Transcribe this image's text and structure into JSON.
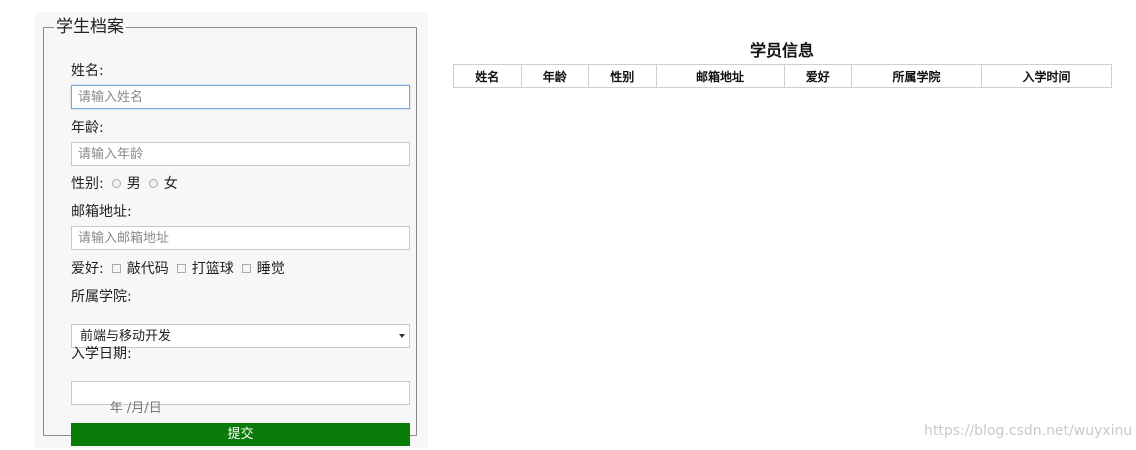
{
  "form": {
    "legend": "学生档案",
    "name": {
      "label": "姓名:",
      "placeholder": "请输入姓名"
    },
    "age": {
      "label": "年龄:",
      "placeholder": "请输入年龄"
    },
    "gender": {
      "label": "性别:",
      "options": [
        "男",
        "女"
      ]
    },
    "email": {
      "label": "邮箱地址:",
      "placeholder": "请输入邮箱地址"
    },
    "hobbies": {
      "label": "爱好:",
      "options": [
        "敲代码",
        "打篮球",
        "睡觉"
      ]
    },
    "college": {
      "label": "所属学院:",
      "selected": "前端与移动开发"
    },
    "enroll_date": {
      "label": "入学日期:",
      "placeholder": "年 /月/日"
    },
    "submit_label": "提交"
  },
  "table": {
    "title": "学员信息",
    "columns": [
      "姓名",
      "年龄",
      "性别",
      "邮箱地址",
      "爱好",
      "所属学院",
      "入学时间"
    ]
  },
  "watermark": "https://blog.csdn.net/wuyxinu",
  "colors": {
    "submit_bg": "#0a7c0a",
    "panel_bg": "#f7f7f7"
  }
}
